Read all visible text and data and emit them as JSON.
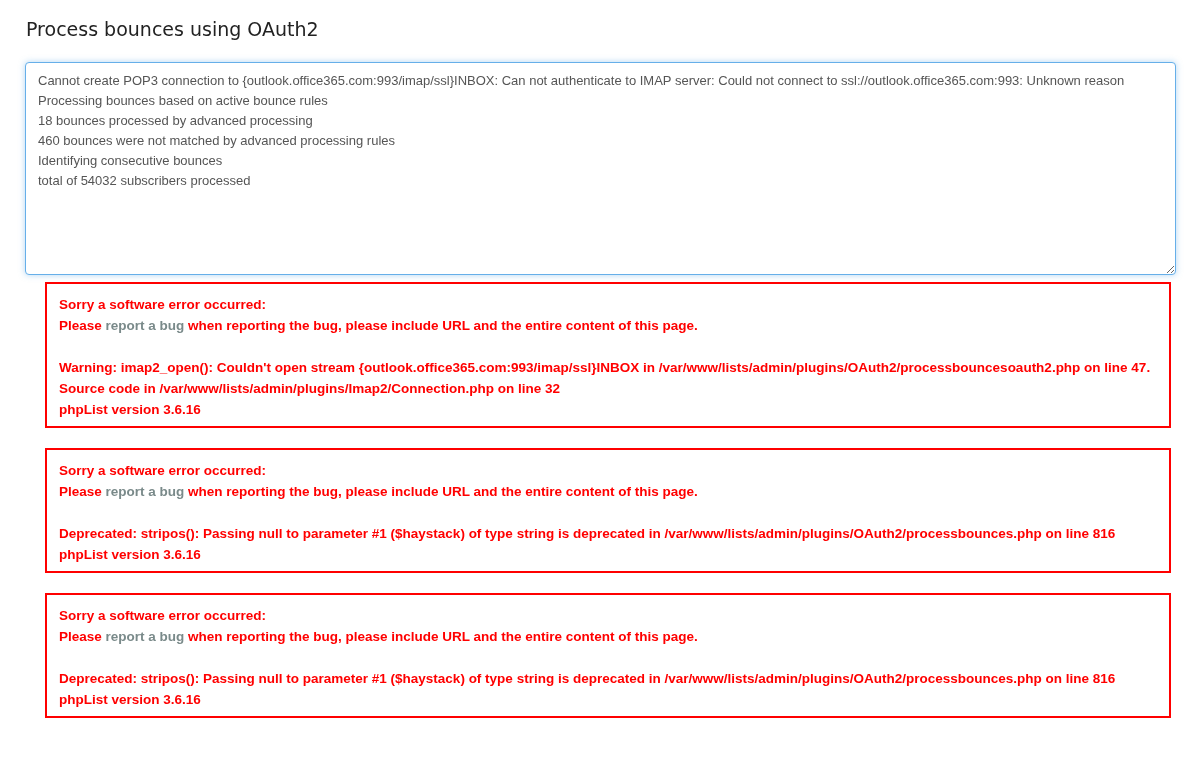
{
  "page": {
    "title": "Process bounces using OAuth2"
  },
  "log": {
    "lines": [
      "Cannot create POP3 connection to {outlook.office365.com:993/imap/ssl}INBOX: Can not authenticate to IMAP server: Could not connect to ssl://outlook.office365.com:993: Unknown reason",
      "Processing bounces based on active bounce rules",
      "18 bounces processed by advanced processing",
      "460 bounces were not matched by advanced processing rules",
      "Identifying consecutive bounces",
      "total of 54032 subscribers processed"
    ]
  },
  "errors": [
    {
      "heading": "Sorry a software error occurred:",
      "before_link": "Please",
      "link": "report a bug",
      "after_link": "when reporting the bug, please include URL and the entire content of this page.",
      "message": "Warning: imap2_open(): Couldn't open stream {outlook.office365.com:993/imap/ssl}INBOX in /var/www/lists/admin/plugins/OAuth2/processbouncesoauth2.php on line 47. Source code in /var/www/lists/admin/plugins/Imap2/Connection.php on line 32",
      "version": "phpList version 3.6.16"
    },
    {
      "heading": "Sorry a software error occurred:",
      "before_link": "Please",
      "link": "report a bug",
      "after_link": "when reporting the bug, please include URL and the entire content of this page.",
      "message": "Deprecated: stripos(): Passing null to parameter #1 ($haystack) of type string is deprecated in /var/www/lists/admin/plugins/OAuth2/processbounces.php on line 816",
      "version": "phpList version 3.6.16"
    },
    {
      "heading": "Sorry a software error occurred:",
      "before_link": "Please",
      "link": "report a bug",
      "after_link": "when reporting the bug, please include URL and the entire content of this page.",
      "message": "Deprecated: stripos(): Passing null to parameter #1 ($haystack) of type string is deprecated in /var/www/lists/admin/plugins/OAuth2/processbounces.php on line 816",
      "version": "phpList version 3.6.16"
    }
  ]
}
